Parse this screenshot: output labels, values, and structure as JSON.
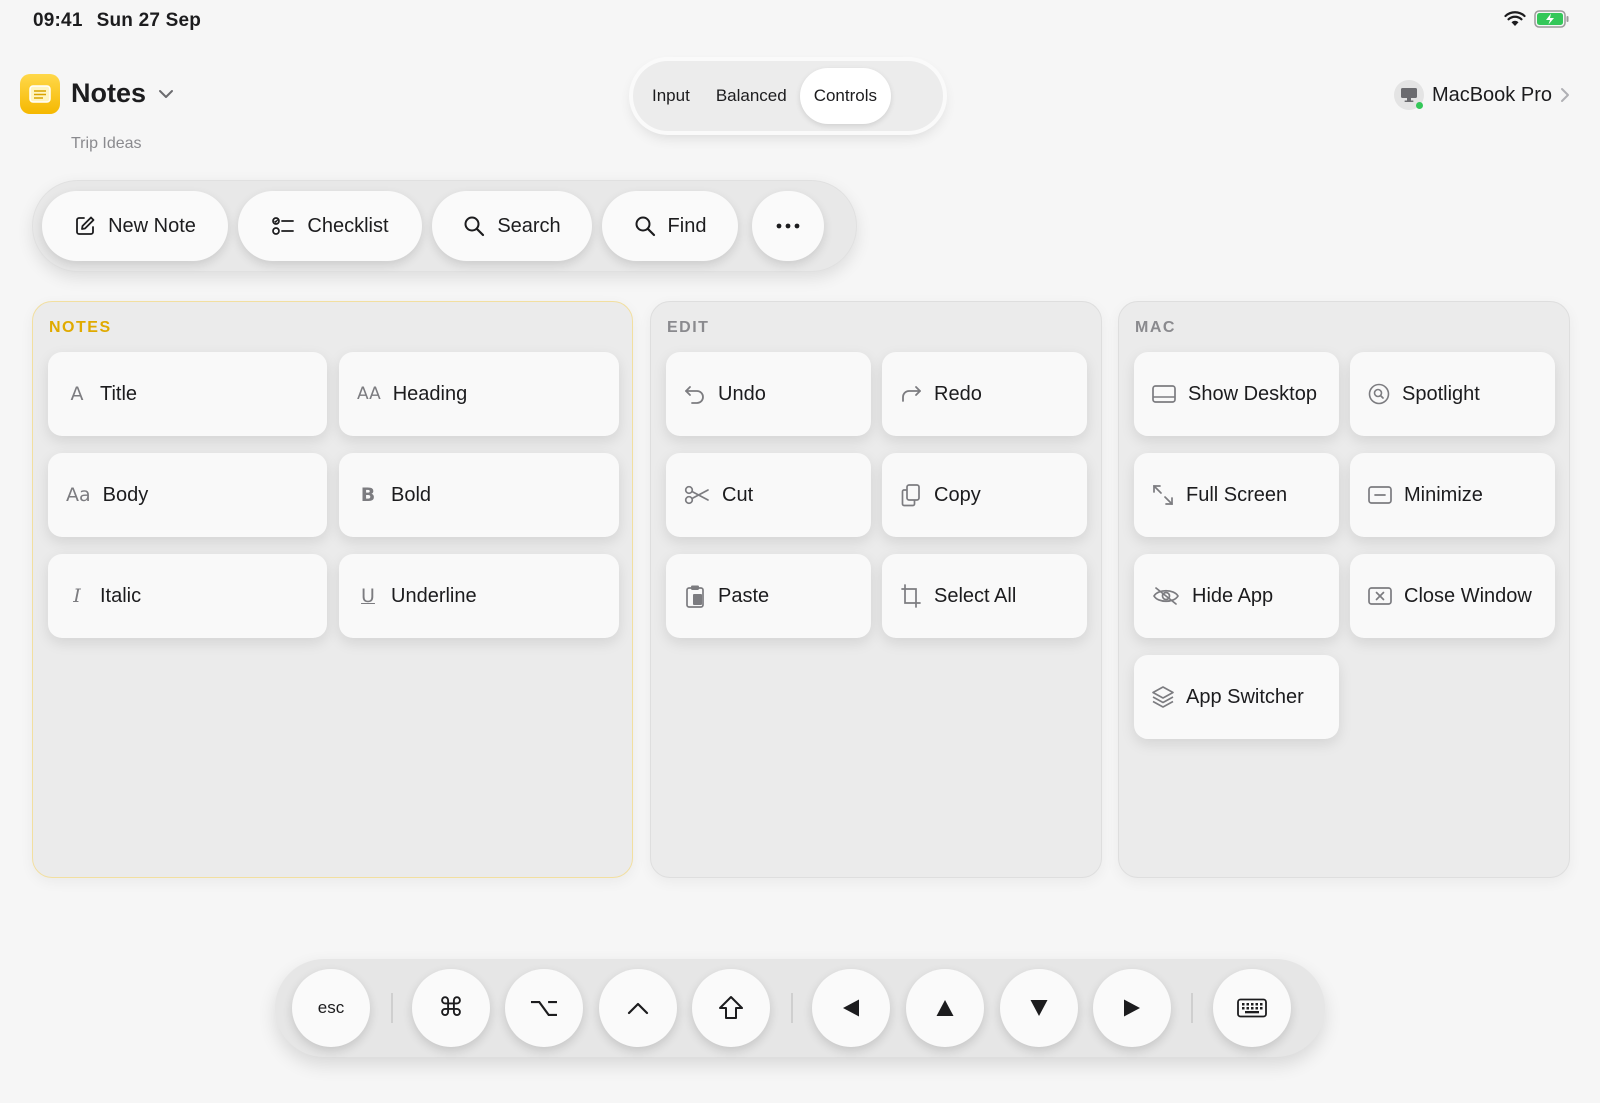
{
  "status": {
    "time": "09:41",
    "date": "Sun 27 Sep"
  },
  "app": {
    "name": "Notes",
    "subtitle": "Trip Ideas"
  },
  "modes": {
    "items": [
      "Input",
      "Balanced",
      "Controls"
    ],
    "active": "Controls"
  },
  "device": {
    "name": "MacBook Pro"
  },
  "toolbar": {
    "new_note": "New Note",
    "checklist": "Checklist",
    "search": "Search",
    "find": "Find"
  },
  "notes_panel": {
    "title": "NOTES",
    "items": [
      {
        "label": "Title",
        "glyph": "A"
      },
      {
        "label": "Heading",
        "glyph": "AA"
      },
      {
        "label": "Body",
        "glyph": "Aa"
      },
      {
        "label": "Bold",
        "glyph": "B"
      },
      {
        "label": "Italic",
        "glyph": "I"
      },
      {
        "label": "Underline",
        "glyph": "U"
      }
    ]
  },
  "edit_panel": {
    "title": "EDIT",
    "items": [
      {
        "label": "Undo"
      },
      {
        "label": "Redo"
      },
      {
        "label": "Cut"
      },
      {
        "label": "Copy"
      },
      {
        "label": "Paste"
      },
      {
        "label": "Select All"
      }
    ]
  },
  "mac_panel": {
    "title": "MAC",
    "items": [
      {
        "label": "Show Desktop"
      },
      {
        "label": "Spotlight"
      },
      {
        "label": "Full Screen"
      },
      {
        "label": "Minimize"
      },
      {
        "label": "Hide App"
      },
      {
        "label": "Close Window"
      },
      {
        "label": "App Switcher"
      }
    ]
  },
  "keys": {
    "esc": "esc",
    "command": "⌘",
    "option": "⌥",
    "control": "^",
    "shift": "⇧",
    "left": "◀",
    "up": "▲",
    "down": "▼",
    "right": "▶"
  },
  "colors": {
    "accent": "#f5b800",
    "battery": "#34c759",
    "notes_title": "#e0aa00"
  }
}
